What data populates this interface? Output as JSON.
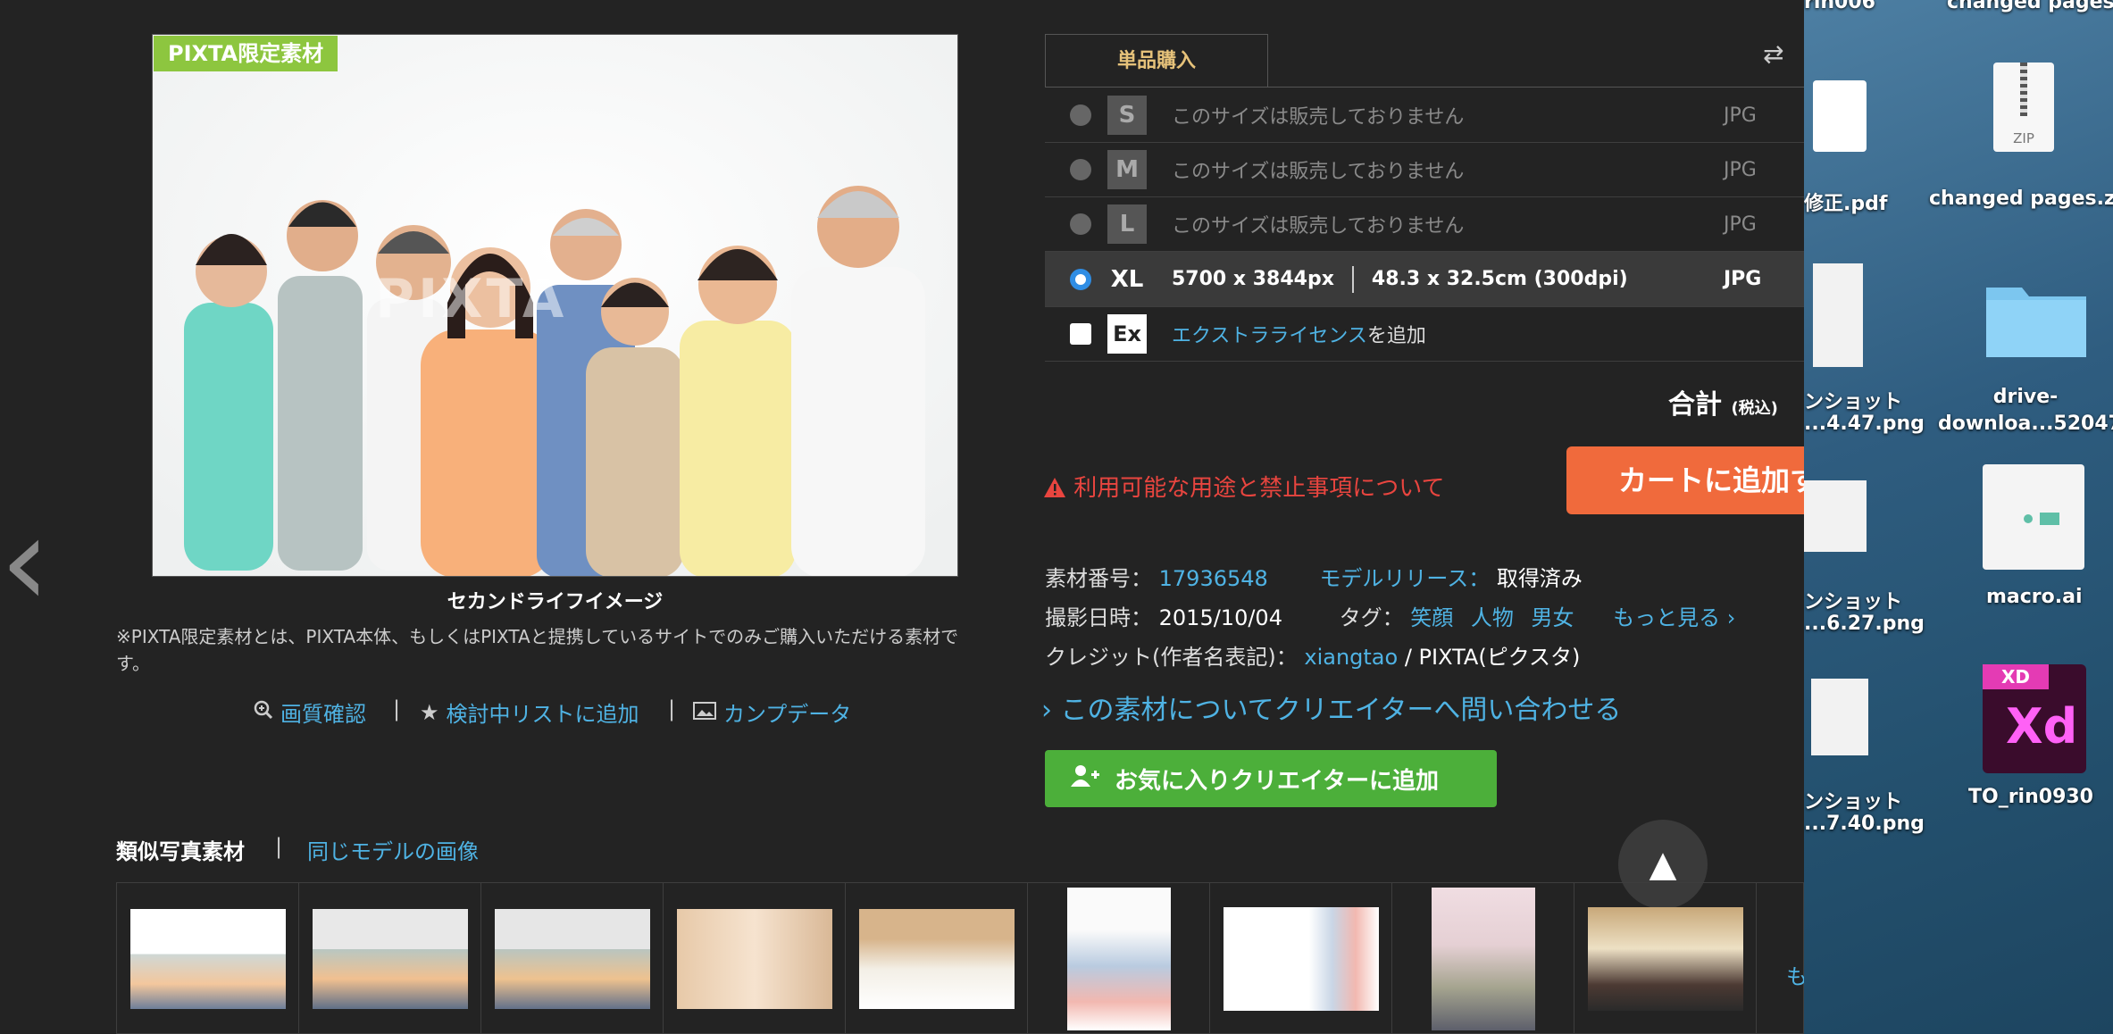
{
  "photo": {
    "badge": "PIXTA限定素材",
    "watermark": "PIXTA",
    "caption": "セカンドライフイメージ",
    "note": "※PIXTA限定素材とは、PIXTA本体、もしくはPIXTAと提携しているサイトでのみご購入いただける素材です。"
  },
  "tools": {
    "quality": "画質確認",
    "wishlist": "検討中リストに追加",
    "comp": "カンプデータ",
    "sep": "|"
  },
  "purchase": {
    "tab": "単品購入",
    "swap": "⇄",
    "rows": [
      {
        "size": "S",
        "text": "このサイズは販売しておりません",
        "format": "JPG"
      },
      {
        "size": "M",
        "text": "このサイズは販売しておりません",
        "format": "JPG"
      },
      {
        "size": "L",
        "text": "このサイズは販売しておりません",
        "format": "JPG"
      },
      {
        "size": "XL",
        "px": "5700 x 3844px",
        "cm": "48.3 x 32.5cm (300dpi)",
        "format": "JPG"
      }
    ],
    "extra": {
      "code": "Ex",
      "link": "エクストラライセンス",
      "suffix": "を追加"
    },
    "total_label": "合計",
    "total_tax": "(税込)",
    "warning": "利用可能な用途と禁止事項について",
    "cart": "カートに追加す"
  },
  "info": {
    "id_label": "素材番号：",
    "id": "17936548",
    "release_label": "モデルリリース：",
    "release": "取得済み",
    "date_label": "撮影日時：",
    "date": "2015/10/04",
    "tag_label": "タグ：",
    "tags": [
      "笑顔",
      "人物",
      "男女"
    ],
    "more": "もっと見る ›",
    "credit_label": "クレジット(作者名表記)：",
    "author": "xiangtao",
    "credit_suffix": " / PIXTA(ピクスタ)"
  },
  "inquiry": "› この素材についてクリエイターへ問い合わせる",
  "fav": "お気に入りクリエイターに追加",
  "totop": "▲",
  "prev": "‹",
  "similar": {
    "label": "類似写真素材",
    "sep": "|",
    "link": "同じモデルの画像",
    "more": "も"
  },
  "desktop": {
    "items": [
      {
        "label": "rin006"
      },
      {
        "label": "changed pages"
      },
      {
        "label": "修正.pdf"
      },
      {
        "label": "changed pages.z"
      },
      {
        "label": "ンショット",
        "sub": "...4.47.png"
      },
      {
        "label": "drive-",
        "sub": "downloa...52047"
      },
      {
        "label": "ンショット",
        "sub": "...6.27.png"
      },
      {
        "label": "macro.ai"
      },
      {
        "label": "ンショット",
        "sub": "...7.40.png"
      },
      {
        "label": "TO_rin0930"
      }
    ],
    "zip": "ZIP",
    "xd_small": "XD",
    "xd_big": "Xd"
  }
}
